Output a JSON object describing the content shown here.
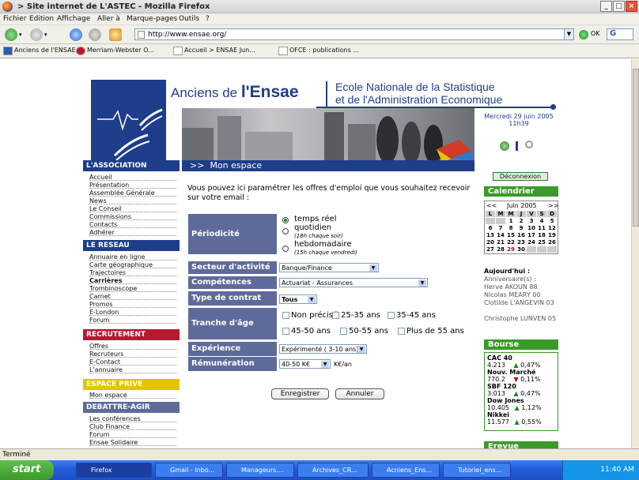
{
  "window": {
    "title": "> Site internet de L'ASTEC - Mozilla Firefox"
  },
  "menu": [
    "Fichier",
    "Edition",
    "Affichage",
    "Aller à",
    "Marque-pages",
    "Outils",
    "?"
  ],
  "address": {
    "url": "http://www.ensae.org/",
    "go_label": "OK",
    "search_glyph": "G"
  },
  "bookmarks": [
    "Anciens de l'ENSAE",
    "Merriam-Webster O...",
    "Accueil > ENSAE Jun...",
    "OFCE : publications ..."
  ],
  "header": {
    "brand_prefix": "Anciens de ",
    "brand_strong": "l'Ensae",
    "school_line1": "Ecole Nationale de la Statistique",
    "school_line2": "et de l'Administration Economique",
    "date": "Mercredi 29 juin 2005",
    "time": "11h39"
  },
  "sidebar": {
    "association": {
      "title": "L'ASSOCIATION",
      "items": [
        "Accueil",
        "Présentation",
        "Assemblée Générale",
        "News",
        "Le Conseil",
        "Commissions",
        "Contacts",
        "Adhérer"
      ]
    },
    "reseau": {
      "title": "LE RESEAU",
      "items": [
        "Annuaire en ligne",
        "Carte géographique",
        "Trajectoires",
        "Carrières",
        "Trombinoscope",
        "Carnet",
        "Promos",
        "E-London",
        "Forum"
      ]
    },
    "recrutement": {
      "title": "RECRUTEMENT",
      "items": [
        "Offres",
        "Recruteurs",
        "E-Contact",
        "L'annuaire"
      ]
    },
    "espace": {
      "title": "ESPACE PRIVE",
      "items": [
        "Mon espace"
      ]
    },
    "debattre": {
      "title": "DEBATTRE-AGIR",
      "items": [
        "Les conférences",
        "Club Finance",
        "Forum",
        "Ensae Solidaire"
      ]
    }
  },
  "main": {
    "heading": "Mon espace",
    "heading_marker": ">>",
    "intro": "Vous pouvez ici paramétrer les offres d'emploi que vous souhaitez recevoir sur votre email :",
    "periodicite": {
      "label": "Périodicité",
      "options": [
        {
          "label": "temps réel",
          "note": ""
        },
        {
          "label": "quotidien",
          "note": "(18h chaque soir)"
        },
        {
          "label": "hebdomadaire",
          "note": "(15h chaque vendredi)"
        }
      ]
    },
    "secteur": {
      "label": "Secteur d'activité",
      "value": "Banque/Finance"
    },
    "competences": {
      "label": "Compétences",
      "value": "Actuariat - Assurances"
    },
    "contrat": {
      "label": "Type de contrat",
      "value": "Tous"
    },
    "age": {
      "label": "Tranche d'âge",
      "options": [
        "Non précisé",
        "25-35 ans",
        "35-45 ans",
        "45-50 ans",
        "50-55 ans",
        "Plus de 55 ans"
      ]
    },
    "experience": {
      "label": "Expérience",
      "value": "Expérimenté ( 3-10 ans)"
    },
    "remuneration": {
      "label": "Rémunération",
      "value": "40-50 K€",
      "unit": "K€/an"
    },
    "save_label": "Enregistrer",
    "cancel_label": "Annuler"
  },
  "right": {
    "logout_label": "Déconnexion",
    "calendar": {
      "title": "Calendrier",
      "prev": "<<",
      "next": ">>",
      "month": "Juin 2005",
      "days": [
        "L",
        "M",
        "M",
        "J",
        "V",
        "S",
        "D"
      ],
      "weeks": [
        [
          "",
          "",
          "1",
          "2",
          "3",
          "4",
          "5"
        ],
        [
          "6",
          "7",
          "8",
          "9",
          "10",
          "11",
          "12"
        ],
        [
          "13",
          "14",
          "15",
          "16",
          "17",
          "18",
          "19"
        ],
        [
          "20",
          "21",
          "22",
          "23",
          "24",
          "25",
          "26"
        ],
        [
          "27",
          "28",
          "29",
          "30",
          "",
          "",
          ""
        ]
      ],
      "today_label": "Aujourd'hui :",
      "birthday_label": "Anniversaire(s) :",
      "birthdays": [
        "Herve AKOUN 88",
        "Nicolas MEARY 00",
        "Clotilde L'ANGEVIN 03",
        "Christophe LUNVEN 05"
      ]
    },
    "bourse": {
      "title": "Bourse",
      "quotes": [
        {
          "name": "CAC 40",
          "value": "4.213",
          "change": "0,47%",
          "dir": "up"
        },
        {
          "name": "Nouv. Marché",
          "value": "770.2",
          "change": "0,11%",
          "dir": "down"
        },
        {
          "name": "SBF 120",
          "value": "3.013",
          "change": "0,47%",
          "dir": "up"
        },
        {
          "name": "Dow Jones",
          "value": "10.405",
          "change": "1,12%",
          "dir": "up"
        },
        {
          "name": "Nikkei",
          "value": "11.577",
          "change": "0,55%",
          "dir": "up"
        }
      ]
    },
    "next_box_title": "Erevue"
  },
  "status": "Terminé",
  "taskbar": {
    "start": "start",
    "tasks": [
      "Firefox",
      "Gmail - Inbo...",
      "Manageurs....",
      "Archives_CR...",
      "Acniens_Ens...",
      "Tutoriel_ens..."
    ],
    "clock": "11:40 AM"
  },
  "colors": {
    "brand": "#1e3d8a",
    "label_bg": "#5e6b9a",
    "green": "#3a9a2a",
    "red_header": "#b81830",
    "yellow_header": "#e2c400"
  }
}
